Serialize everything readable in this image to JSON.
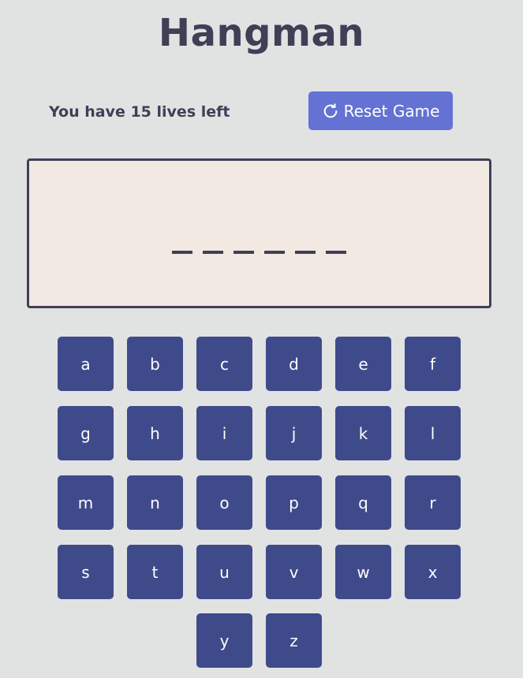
{
  "game": {
    "title": "Hangman",
    "lives_prefix": "You have ",
    "lives_count": "15",
    "lives_suffix": " lives left",
    "reset_label": "Reset Game",
    "reset_icon": "refresh-icon",
    "word_slots": [
      "_",
      "_",
      "_",
      "_",
      "_",
      "_"
    ],
    "revealed_letters": [
      "",
      "",
      "",
      "",
      "",
      ""
    ]
  },
  "keyboard": {
    "rows": [
      [
        "a",
        "b",
        "c",
        "d",
        "e",
        "f"
      ],
      [
        "g",
        "h",
        "i",
        "j",
        "k",
        "l"
      ],
      [
        "m",
        "n",
        "o",
        "p",
        "q",
        "r"
      ],
      [
        "s",
        "t",
        "u",
        "v",
        "w",
        "x"
      ],
      [
        "y",
        "z"
      ]
    ]
  },
  "colors": {
    "background": "#e1e3e3",
    "text": "#3f3f56",
    "accent": "#6372d3",
    "key": "#3f4a8b",
    "word_box": "#f2e9e2"
  }
}
